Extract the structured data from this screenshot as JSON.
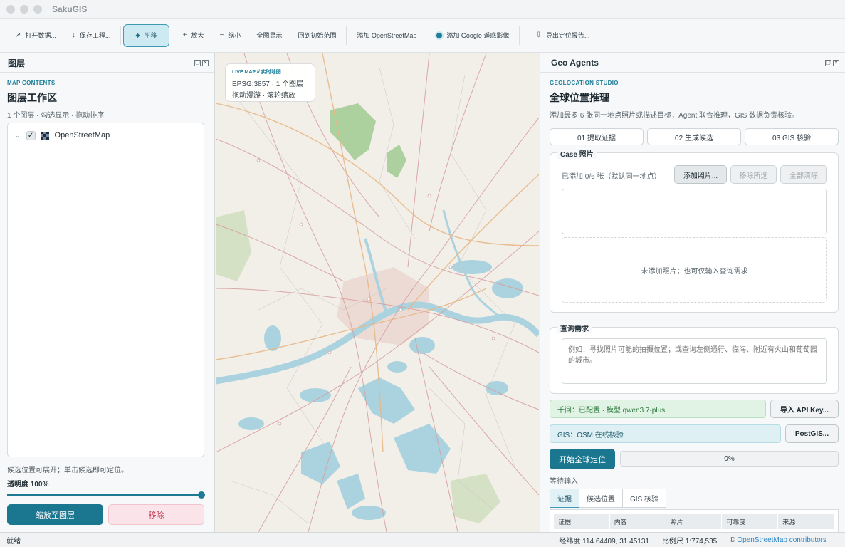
{
  "app": {
    "title": "SakuGIS"
  },
  "toolbar": {
    "open_data": "打开数据...",
    "save_project": "保存工程...",
    "pan": "平移",
    "zoom_in": "放大",
    "zoom_out": "缩小",
    "full_extent": "全图显示",
    "initial_extent": "回到初始范围",
    "add_osm": "添加 OpenStreetMap",
    "add_google": "添加 Google 遥感影像",
    "export_report": "导出定位报告..."
  },
  "layers_panel": {
    "title": "图层",
    "eyebrow": "MAP CONTENTS",
    "heading": "图层工作区",
    "subtitle": "1 个图层 · 勾选显示 · 拖动排序",
    "layers": [
      {
        "name": "OpenStreetMap",
        "checked": true
      }
    ],
    "hint": "候选位置可展开；单击候选即可定位。",
    "opacity_label": "透明度 100%",
    "opacity_value": 1.0,
    "zoom_to_layer": "缩放至图层",
    "remove": "移除"
  },
  "map": {
    "live_eyebrow": "LIVE MAP // 实时地图",
    "crs_info": "EPSG:3857 · 1 个图层",
    "interaction_hint": "拖动漫游 · 滚轮缩放"
  },
  "geo_panel": {
    "title": "Geo Agents",
    "eyebrow": "GEOLOCATION STUDIO",
    "heading": "全球位置推理",
    "description": "添加最多 6 张同一地点照片或描述目标，Agent 联合推理，GIS 数据负责核验。",
    "steps": [
      "01 提取证据",
      "02 生成候选",
      "03 GIS 核验"
    ],
    "case_photos": {
      "title": "Case 照片",
      "count_text": "已添加 0/6 张（默认同一地点）",
      "add_photo": "添加照片...",
      "remove_selected": "移除所选",
      "clear_all": "全部清除",
      "empty_text": "未添加照片；也可仅输入查询需求"
    },
    "query": {
      "title": "查询需求",
      "placeholder": "例如：寻找照片可能的拍摄位置；或查询左侧通行、临海、附近有火山和葡萄园的城市。"
    },
    "qwen_status": "千问：已配置 · 模型 qwen3.7-plus",
    "import_api_key": "导入 API Key...",
    "gis_status": "GIS：OSM 在线核验",
    "postgis": "PostGIS...",
    "start_button": "开始全球定位",
    "progress_text": "0%",
    "progress_value": 0,
    "waiting_text": "等待输入",
    "tabs": [
      "证据",
      "候选位置",
      "GIS 核验"
    ],
    "table_headers": [
      "证据",
      "内容",
      "照片",
      "可靠度",
      "来源"
    ]
  },
  "statusbar": {
    "ready": "就绪",
    "coords": "经纬度 114.64409, 31.45131",
    "scale": "比例尺 1:774,535",
    "attribution_prefix": "©",
    "attribution_link": "OpenStreetMap contributors"
  },
  "colors": {
    "accent": "#1b7690",
    "map_background": "#f2efe9",
    "water": "#aad3df",
    "forest": "#add19e",
    "urban": "#e8c9c3"
  }
}
